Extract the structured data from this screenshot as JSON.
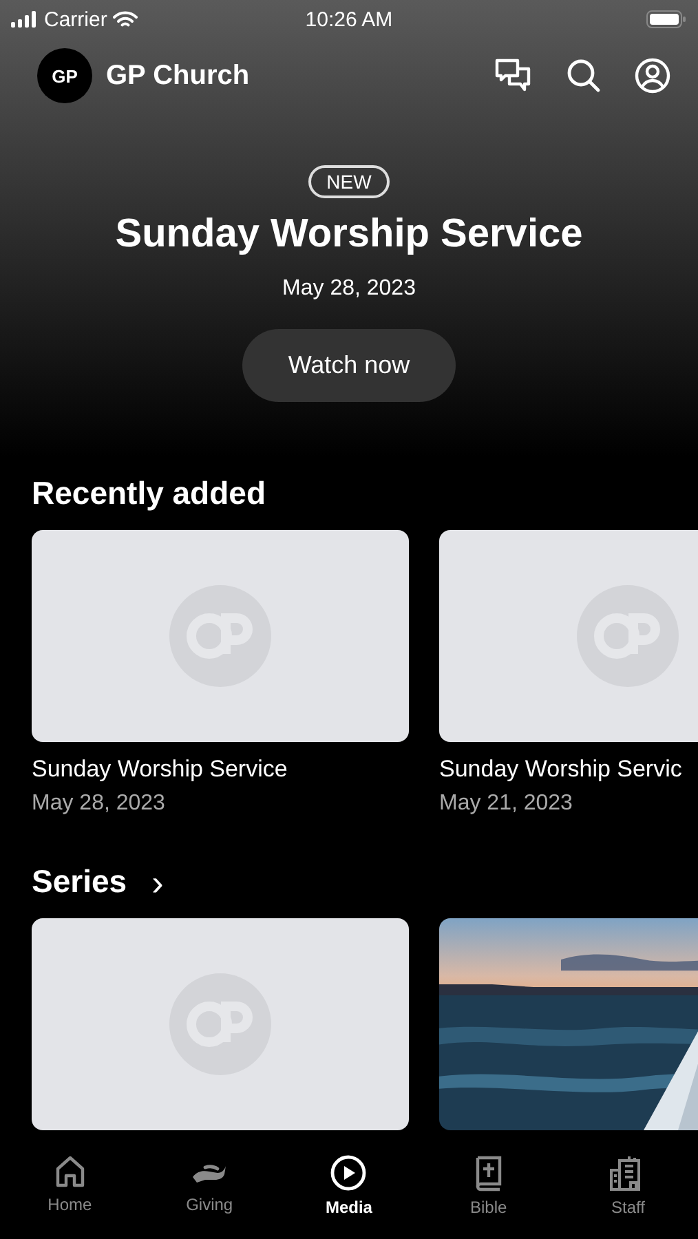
{
  "status_bar": {
    "carrier": "Carrier",
    "time": "10:26 AM"
  },
  "header": {
    "logo": "GP",
    "title": "GP Church"
  },
  "hero": {
    "badge": "NEW",
    "title": "Sunday Worship Service",
    "date": "May 28, 2023",
    "button": "Watch now"
  },
  "recently_added": {
    "title": "Recently added",
    "items": [
      {
        "kind": "placeholder",
        "title": "Sunday Worship Service",
        "date": "May 28, 2023"
      },
      {
        "kind": "placeholder",
        "title": "Sunday Worship Servic",
        "date": "May 21, 2023"
      }
    ]
  },
  "series": {
    "title": "Series",
    "chevron": "›",
    "items": [
      {
        "kind": "placeholder"
      },
      {
        "kind": "picture"
      }
    ]
  },
  "tab_bar": [
    {
      "label": "Home",
      "kind": "home",
      "selected": false
    },
    {
      "label": "Giving",
      "kind": "giving",
      "selected": false
    },
    {
      "label": "Media",
      "kind": "media",
      "selected": true
    },
    {
      "label": "Bible",
      "kind": "bible",
      "selected": false
    },
    {
      "label": "Staff",
      "kind": "staff",
      "selected": false
    }
  ]
}
